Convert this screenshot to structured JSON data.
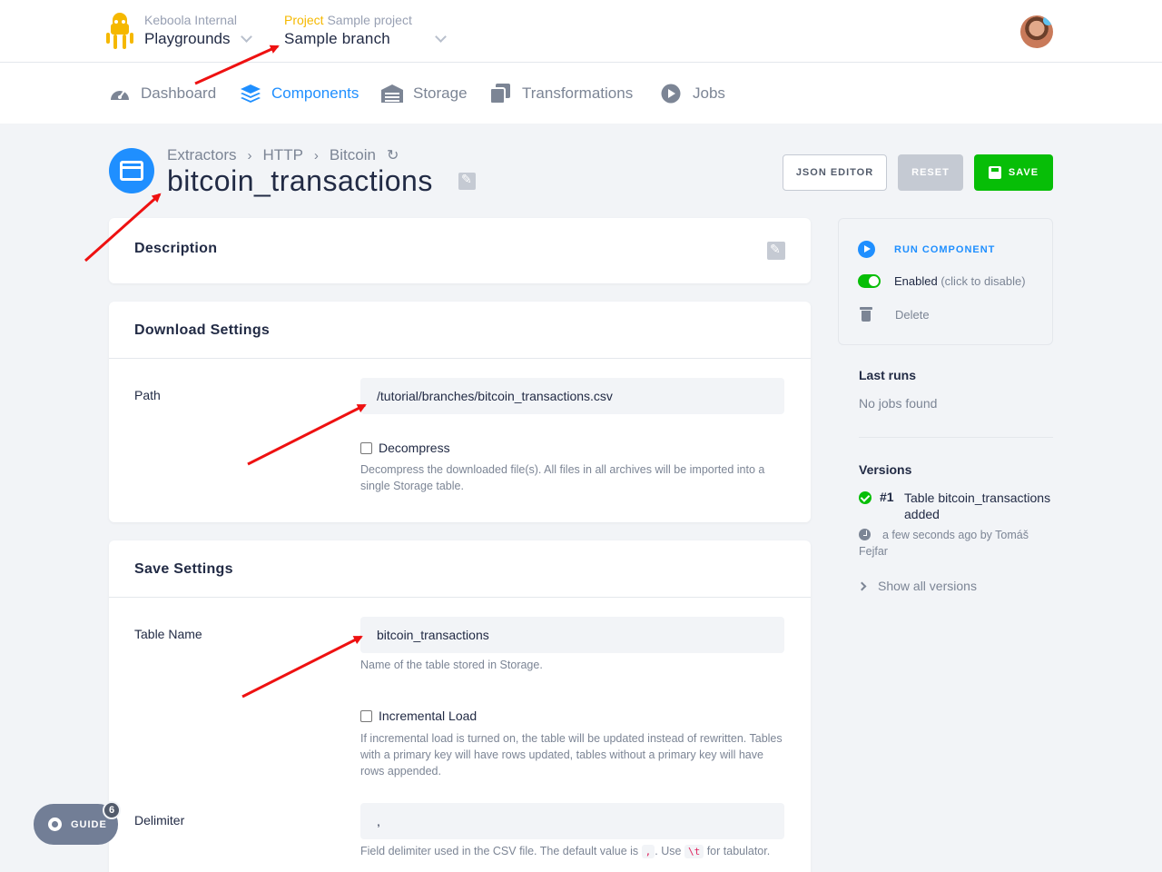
{
  "header": {
    "org_label": "Keboola Internal",
    "org_name": "Playgrounds",
    "project_prefix": "Project",
    "project_name": "Sample project",
    "branch_name": "Sample branch"
  },
  "nav": {
    "items": [
      {
        "label": "Dashboard",
        "icon": "gauge-icon",
        "active": false
      },
      {
        "label": "Components",
        "icon": "layers-icon",
        "active": true
      },
      {
        "label": "Storage",
        "icon": "warehouse-icon",
        "active": false
      },
      {
        "label": "Transformations",
        "icon": "copy-icon",
        "active": false
      },
      {
        "label": "Jobs",
        "icon": "play-circle-icon",
        "active": false
      }
    ]
  },
  "page": {
    "breadcrumbs": [
      "Extractors",
      "HTTP",
      "Bitcoin"
    ],
    "title": "bitcoin_transactions",
    "buttons": {
      "json_editor": "JSON EDITOR",
      "reset": "RESET",
      "save": "SAVE"
    }
  },
  "description_card": {
    "title": "Description"
  },
  "download_settings": {
    "title": "Download Settings",
    "path_label": "Path",
    "path_value": "/tutorial/branches/bitcoin_transactions.csv",
    "decompress_label": "Decompress",
    "decompress_checked": false,
    "decompress_help": "Decompress the downloaded file(s). All files in all archives will be imported into a single Storage table."
  },
  "save_settings": {
    "title": "Save Settings",
    "table_name_label": "Table Name",
    "table_name_value": "bitcoin_transactions",
    "table_name_help": "Name of the table stored in Storage.",
    "incremental_label": "Incremental Load",
    "incremental_checked": false,
    "incremental_help": "If incremental load is turned on, the table will be updated instead of rewritten. Tables with a primary key will have rows updated, tables without a primary key will have rows appended.",
    "delimiter_label": "Delimiter",
    "delimiter_value": ",",
    "delimiter_help_prefix": "Field delimiter used in the CSV file. The default value is",
    "delimiter_help_code1": ",",
    "delimiter_help_mid": ". Use",
    "delimiter_help_code2": "\\t",
    "delimiter_help_suffix": "for tabulator."
  },
  "sidebar": {
    "run_component": "RUN COMPONENT",
    "enabled_label": "Enabled",
    "enabled_hint": "(click to disable)",
    "delete_label": "Delete",
    "last_runs_title": "Last runs",
    "last_runs_empty": "No jobs found",
    "versions_title": "Versions",
    "version_number": "#1",
    "version_text": "Table bitcoin_transactions added",
    "version_meta": "a few seconds ago by Tomáš Fejfar",
    "show_all_versions": "Show all versions"
  },
  "guide": {
    "label": "GUIDE",
    "badge": "6"
  },
  "colors": {
    "accent": "#1f8fff",
    "save_green": "#07be07",
    "project_yellow": "#f5b800",
    "annotation_red": "#ee1111"
  }
}
